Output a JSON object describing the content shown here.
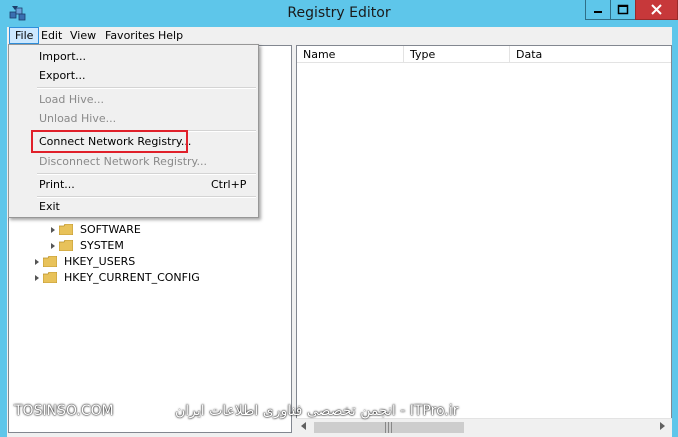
{
  "window": {
    "title": "Registry Editor",
    "accent_color": "#5ec6ea",
    "close_button_color": "#c7383a",
    "app_icon": "registry-editor-icon"
  },
  "menubar": {
    "items": [
      {
        "label": "File"
      },
      {
        "label": "Edit"
      },
      {
        "label": "View"
      },
      {
        "label": "Favorites"
      },
      {
        "label": "Help"
      }
    ]
  },
  "file_menu": {
    "items": [
      {
        "label": "Import...",
        "enabled": true
      },
      {
        "label": "Export...",
        "enabled": true
      },
      {
        "label": "Load Hive...",
        "enabled": false
      },
      {
        "label": "Unload Hive...",
        "enabled": false
      },
      {
        "label": "Connect Network Registry...",
        "enabled": true,
        "highlighted": true
      },
      {
        "label": "Disconnect Network Registry...",
        "enabled": false
      },
      {
        "label": "Print...",
        "enabled": true,
        "shortcut": "Ctrl+P"
      },
      {
        "label": "Exit",
        "enabled": true
      }
    ],
    "highlight_color": "#e0202a"
  },
  "tree": {
    "items": [
      {
        "label": "SOFTWARE",
        "icon": "folder-icon"
      },
      {
        "label": "SYSTEM",
        "icon": "folder-icon"
      },
      {
        "label": "HKEY_USERS",
        "icon": "folder-icon"
      },
      {
        "label": "HKEY_CURRENT_CONFIG",
        "icon": "folder-icon"
      }
    ]
  },
  "list": {
    "columns": [
      {
        "label": "Name"
      },
      {
        "label": "Type"
      },
      {
        "label": "Data"
      }
    ]
  },
  "watermark": {
    "left_text": "TOSINSO.COM",
    "right_text": "ITPro.ir - انجمن تخصصی فناوری اطلاعات ایران"
  }
}
